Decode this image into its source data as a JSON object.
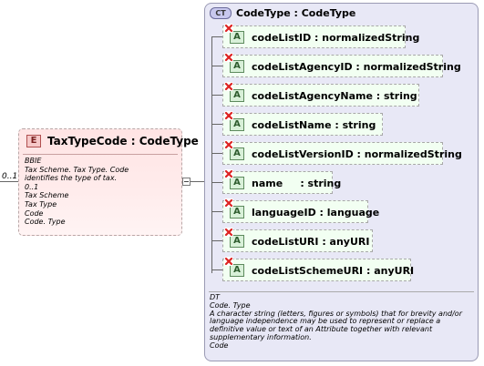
{
  "element": {
    "badge": "E",
    "name": "TaxTypeCode : CodeType",
    "multiplicity": "0..1",
    "doc_lines": [
      "BBIE",
      "Tax Scheme. Tax Type. Code",
      "identifies the type of tax.",
      "0..1",
      "Tax Scheme",
      "Tax Type",
      "Code",
      "Code. Type"
    ]
  },
  "complex_type": {
    "badge": "CT",
    "title": "CodeType : CodeType",
    "attributes": [
      {
        "badge": "A",
        "label": "codeListID : normalizedString"
      },
      {
        "badge": "A",
        "label": "codeListAgencyID : normalizedString"
      },
      {
        "badge": "A",
        "label": "codeListAgencyName : string"
      },
      {
        "badge": "A",
        "label": "codeListName : string"
      },
      {
        "badge": "A",
        "label": "codeListVersionID : normalizedString"
      },
      {
        "badge": "A",
        "label": "name     : string"
      },
      {
        "badge": "A",
        "label": "languageID : language"
      },
      {
        "badge": "A",
        "label": "codeListURI : anyURI"
      },
      {
        "badge": "A",
        "label": "codeListSchemeURI : anyURI"
      }
    ],
    "doc_lines": [
      "DT",
      "Code. Type",
      "A character string (letters, figures or symbols) that for brevity and/or language independence may be used to represent or replace a definitive value or text of an Attribute together with relevant supplementary information.",
      "Code"
    ]
  }
}
